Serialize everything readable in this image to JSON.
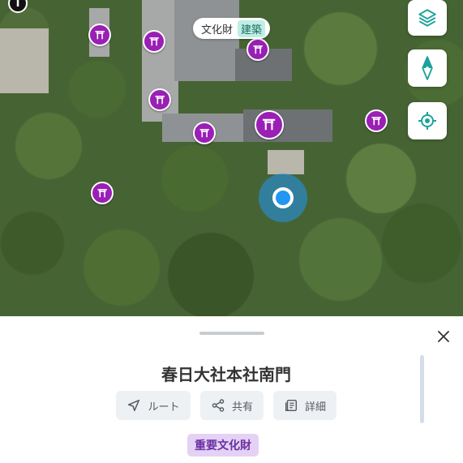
{
  "map": {
    "tooltip": {
      "label": "文化財",
      "tag": "建築"
    },
    "controls": [
      {
        "name": "layers-button",
        "icon": "layers-icon"
      },
      {
        "name": "compass-button",
        "icon": "compass-icon"
      },
      {
        "name": "locate-button",
        "icon": "locate-icon"
      }
    ],
    "info_icon": "i",
    "pin_icon": "torii-gate-icon",
    "colors": {
      "pin": "#9a1fb5",
      "location": "#2196f3",
      "accent": "#1aa39a"
    }
  },
  "sheet": {
    "title": "春日大社本社南門",
    "actions": [
      {
        "label": "ルート",
        "icon": "navigation-arrow-icon"
      },
      {
        "label": "共有",
        "icon": "share-icon"
      },
      {
        "label": "詳細",
        "icon": "details-icon"
      }
    ],
    "badge": "重要文化財",
    "close_icon": "close-icon"
  }
}
